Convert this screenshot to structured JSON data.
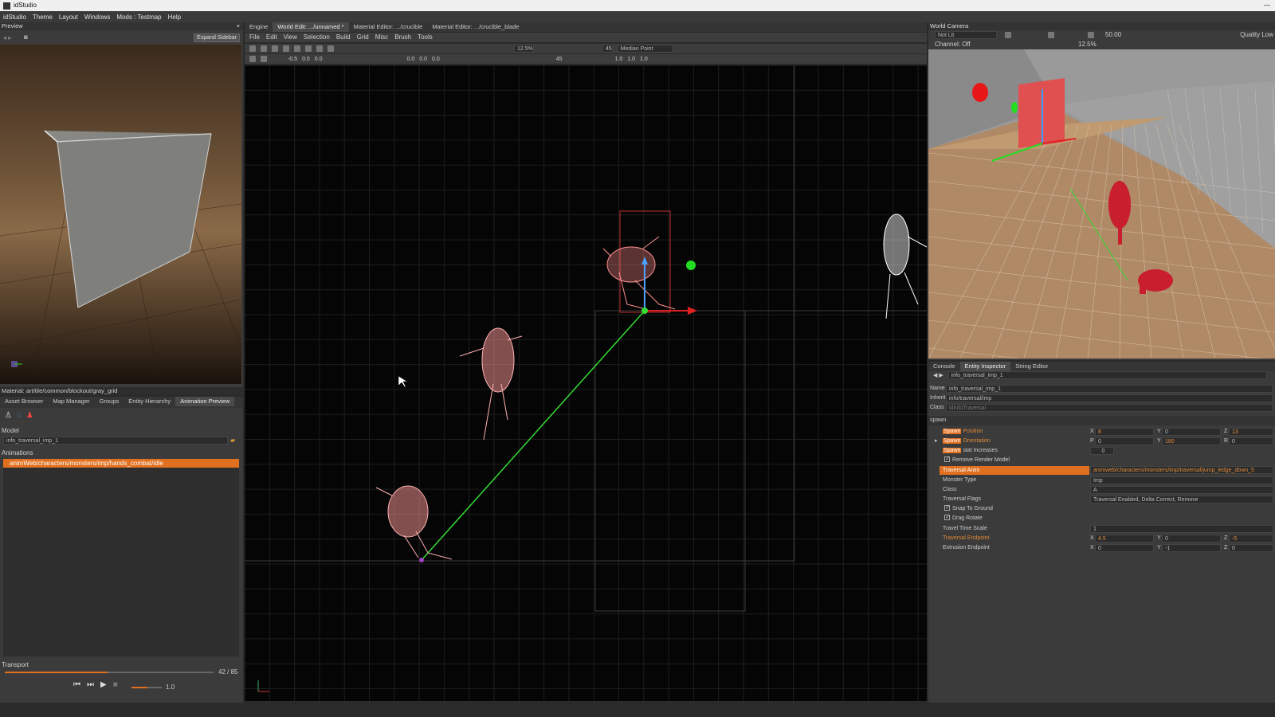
{
  "app": {
    "title": "idStudio"
  },
  "menubar": [
    "idStudio",
    "Theme",
    "Layout",
    "Windows",
    "Mods : Testmap",
    "Help"
  ],
  "preview": {
    "title": "Preview",
    "expand_label": "Expand Sidebar",
    "material_path": "Material: art/tile/common/blockout/gray_grid"
  },
  "left_tabs": [
    "Asset Browser",
    "Map Manager",
    "Groups",
    "Entity Hierarchy",
    "Animation Preview"
  ],
  "anim_preview": {
    "model_label": "Model",
    "model_value": "info_traversal_imp_1",
    "animations_label": "Animations",
    "selected_animation": "animWeb/characters/monsters/imp/hands_combat/idle",
    "transport_label": "Transport",
    "frame_counter": "42 / 85",
    "frame_progress": 0.494,
    "speed_value": "1.0"
  },
  "center_tabs": [
    "Engine",
    "World Edit: .../unnamed *",
    "Material Editor: .../crucible",
    "Material Editor: .../crucible_blade"
  ],
  "center_menu": [
    "File",
    "Edit",
    "View",
    "Selection",
    "Build",
    "Grid",
    "Misc",
    "Brush",
    "Tools"
  ],
  "center_toolbar": {
    "zoom": "12.5%",
    "angle": "45",
    "pivot": "Median Point",
    "row2": [
      "-0.5",
      "0.0",
      "0.0",
      "0.0",
      "0.0",
      "0.0",
      "45",
      "1.0",
      "1.0",
      "1.0"
    ]
  },
  "world_camera": {
    "title": "World Camera",
    "lighting": "Not Lit",
    "channel": "Channel: Off",
    "speed": "50.00",
    "zoom": "12.5%",
    "quality": "Quality Low"
  },
  "inspector_tabs": [
    "Console",
    "Entity Inspector",
    "String Editor"
  ],
  "inspector": {
    "entity": "info_traversal_imp_1",
    "name_label": "Name",
    "name_value": "info_traversal_imp_1",
    "inherit_label": "Inherit",
    "inherit_value": "info/traversal/imp",
    "class_label": "Class",
    "class_value": "idInfoTraversal",
    "spawn_section": "spawn",
    "spawn_word": "Spawn",
    "position_label": "Position",
    "position": {
      "x": "8",
      "y": "0",
      "z": "13"
    },
    "orientation_label": "Orientation",
    "orientation": {
      "p": "0",
      "y": "180",
      "r": "0"
    },
    "stat_label": "stat Increases",
    "stat_value": "0",
    "remove_render_label": "Remove Render Model",
    "traversal_anim_label": "Traversal Anim",
    "traversal_anim_value": "animweb/characters/monsters/imp/traversal/jump_ledge_down_5",
    "monster_type_label": "Monster Type",
    "monster_type": "Imp",
    "class2_label": "Class",
    "class2_value": "A",
    "flags_label": "Traversal Flags",
    "flags_value": "Traversal Enabled, Delta Correct, Remove",
    "snap_label": "Snap To Ground",
    "drag_label": "Drag Rotate",
    "time_scale_label": "Travel Time Scale",
    "time_scale": "1",
    "endpoint_label": "Traversal Endpoint",
    "endpoint": {
      "x": "4.5",
      "y": "0",
      "z": "-5"
    },
    "extrusion_label": "Extrusion Endpoint",
    "extrusion": {
      "x": "0",
      "y": "-1",
      "z": "0"
    }
  },
  "colors": {
    "accent": "#e07020",
    "grid_bg": "#050505",
    "selection": "#ff8888",
    "link": "#33dd33"
  }
}
